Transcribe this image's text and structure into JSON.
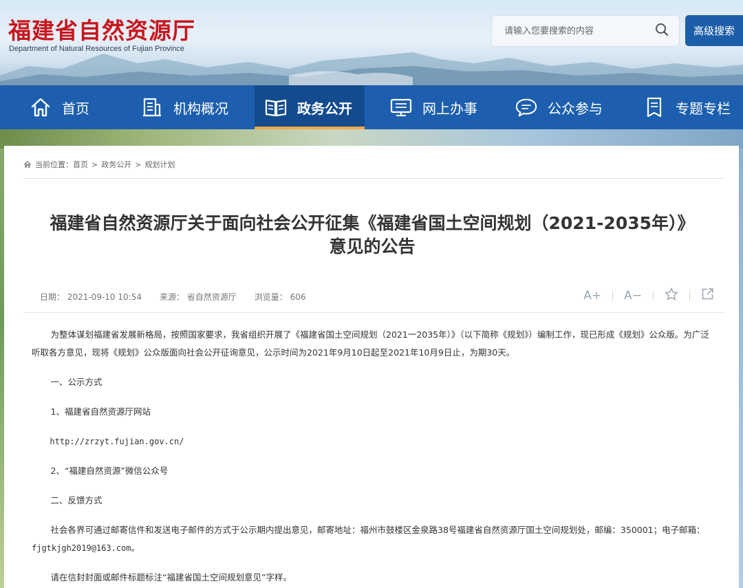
{
  "header": {
    "logo_cn": "福建省自然资源厅",
    "logo_en": "Department of Natural Resources of Fujian Province",
    "search_placeholder": "请输入您要搜索的内容",
    "advanced_search": "高级搜索"
  },
  "nav": {
    "items": [
      {
        "label": "首页",
        "icon": "home-icon"
      },
      {
        "label": "机构概况",
        "icon": "building-icon"
      },
      {
        "label": "政务公开",
        "icon": "book-icon"
      },
      {
        "label": "网上办事",
        "icon": "monitor-icon"
      },
      {
        "label": "公众参与",
        "icon": "chat-icon"
      },
      {
        "label": "专题专栏",
        "icon": "bookmark-icon"
      }
    ],
    "active_index": 2
  },
  "breadcrumb": {
    "prefix": "当前位置：",
    "items": [
      "首页",
      "政务公开",
      "规划计划"
    ],
    "separator": ">"
  },
  "article": {
    "title_line1": "福建省自然资源厅关于面向社会公开征集《福建省国土空间规划（2021-2035年）》",
    "title_line2": "意见的公告",
    "meta": {
      "date": "日期：  2021-09-10 10:54",
      "source": "来源：  省自然资源厅",
      "views": "浏览量：  606"
    },
    "tools": {
      "font_larger": "A+",
      "font_smaller": "A−"
    },
    "paragraphs": {
      "p1": "为整体谋划福建省发展新格局，按照国家要求，我省组织开展了《福建省国土空间规划（2021一2035年）》（以下简称《规划》）编制工作，现已形成《规划》公众版。为广泛听取各方意见，现将《规划》公众版面向社会公开征询意见，公示时间为2021年9月10日起至2021年10月9日止，为期30天。",
      "p2": "一、公示方式",
      "p3": "1、福建省自然资源厅网站",
      "p4": "http://zrzyt.fujian.gov.cn/",
      "p5": "2、“福建自然资源”微信公众号",
      "p6": "二、反馈方式",
      "p7_text": "社会各界可通过邮寄信件和发送电子邮件的方式于公示期内提出意见，邮寄地址：福州市鼓楼区金泉路38号福建省自然资源厅国土空间规划处，邮编：350001；电子邮箱：",
      "p7_email": "fjgtkjgh2019@163.com",
      "p7_end": "。",
      "p8": "请在信封封面或邮件标题标注“福建省国土空间规划意见”字样。"
    }
  },
  "colors": {
    "nav_bg": "#1d5fae",
    "nav_active_bg": "#144b8f",
    "nav_active_underline": "#f0a84a",
    "logo_red": "#c8161d",
    "adv_btn": "#1d5ea8"
  }
}
